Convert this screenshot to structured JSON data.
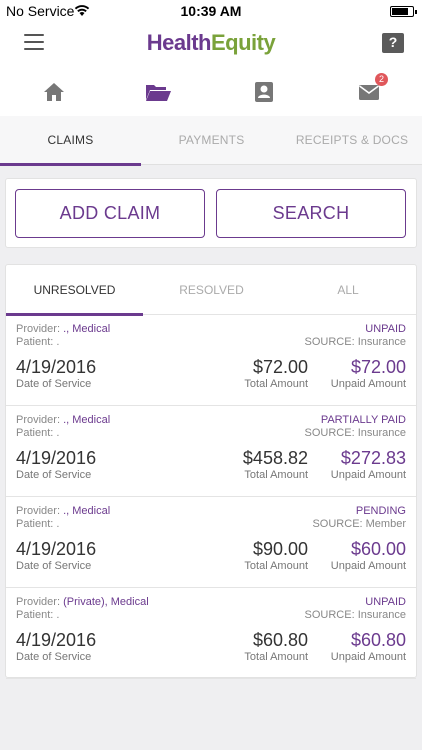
{
  "status_bar": {
    "carrier": "No Service",
    "time": "10:39 AM"
  },
  "header": {
    "logo_part1": "Health",
    "logo_part2": "Equity",
    "help_label": "?"
  },
  "nav": {
    "icons": [
      "home-icon",
      "folder-icon",
      "contact-card-icon",
      "mail-icon"
    ],
    "mail_badge": "2"
  },
  "tabs": [
    "CLAIMS",
    "PAYMENTS",
    "RECEIPTS & DOCS"
  ],
  "actions": {
    "add_claim": "ADD CLAIM",
    "search": "SEARCH"
  },
  "subtabs": [
    "UNRESOLVED",
    "RESOLVED",
    "ALL"
  ],
  "labels": {
    "provider": "Provider:",
    "patient": "Patient:",
    "patient_value": ".",
    "date_of_service": "Date of Service",
    "total_amount": "Total Amount",
    "unpaid_amount": "Unpaid Amount"
  },
  "claims": [
    {
      "provider": "., Medical",
      "status": "UNPAID",
      "source": "SOURCE: Insurance",
      "date": "4/19/2016",
      "total": "$72.00",
      "unpaid": "$72.00"
    },
    {
      "provider": "., Medical",
      "status": "PARTIALLY PAID",
      "source": "SOURCE: Insurance",
      "date": "4/19/2016",
      "total": "$458.82",
      "unpaid": "$272.83"
    },
    {
      "provider": "., Medical",
      "status": "PENDING",
      "source": "SOURCE: Member",
      "date": "4/19/2016",
      "total": "$90.00",
      "unpaid": "$60.00"
    },
    {
      "provider": "(Private), Medical",
      "status": "UNPAID",
      "source": "SOURCE: Insurance",
      "date": "4/19/2016",
      "total": "$60.80",
      "unpaid": "$60.80"
    }
  ],
  "colors": {
    "brand_purple": "#6b3a8e",
    "brand_green": "#7aa23a",
    "badge_red": "#e0575b"
  }
}
